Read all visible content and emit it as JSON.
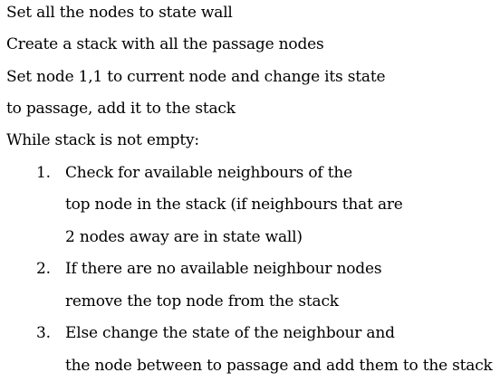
{
  "intro_lines": [
    "Set all the nodes to state wall",
    "Create a stack with all the passage nodes",
    "Set node 1,1 to current node and change its state",
    "to passage, add it to the stack",
    "While stack is not empty:"
  ],
  "steps": [
    {
      "number": "1.",
      "lines": [
        "Check for available neighbours of the",
        "top node in the stack (if neighbours that are",
        "2 nodes away are in state wall)"
      ]
    },
    {
      "number": "2.",
      "lines": [
        "If there are no available neighbour nodes",
        "remove the top node from the stack"
      ]
    },
    {
      "number": "3.",
      "lines": [
        "Else change the state of the neighbour and",
        "the node between to passage and add them to the stack"
      ]
    }
  ]
}
